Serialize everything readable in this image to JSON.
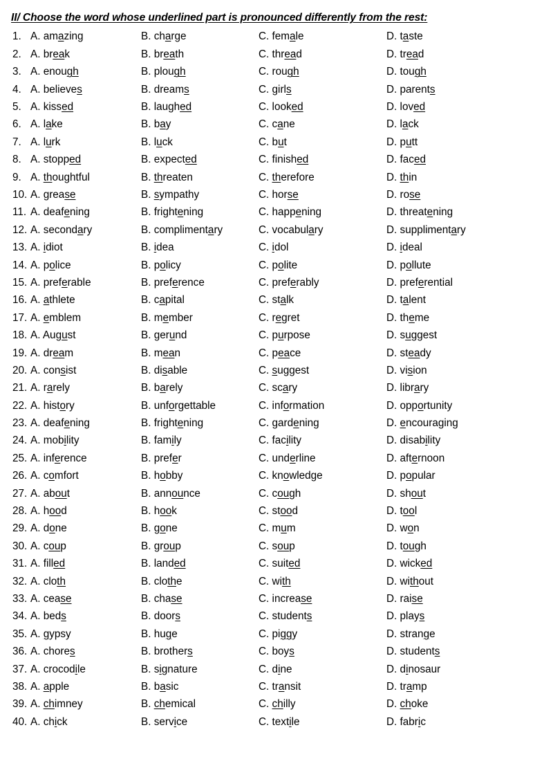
{
  "heading": "II/ Choose the word whose underlined part is pronounced differently from the rest:",
  "columns": [
    "A.",
    "B.",
    "C.",
    "D."
  ],
  "questions": [
    {
      "n": "1.",
      "a": [
        "am",
        "a",
        "zing"
      ],
      "b": [
        "ch",
        "a",
        "rge"
      ],
      "c": [
        "fem",
        "a",
        "le"
      ],
      "d": [
        "t",
        "a",
        "ste"
      ]
    },
    {
      "n": "2.",
      "a": [
        "br",
        "ea",
        "k"
      ],
      "b": [
        "br",
        "ea",
        "th"
      ],
      "c": [
        "thr",
        "ea",
        "d"
      ],
      "d": [
        "tr",
        "ea",
        "d"
      ]
    },
    {
      "n": "3.",
      "a": [
        "enou",
        "gh",
        ""
      ],
      "b": [
        "plou",
        "gh",
        ""
      ],
      "c": [
        "rou",
        "gh",
        ""
      ],
      "d": [
        "tou",
        "gh",
        ""
      ]
    },
    {
      "n": "4.",
      "a": [
        "believe",
        "s",
        ""
      ],
      "b": [
        "dream",
        "s",
        ""
      ],
      "c": [
        "girl",
        "s",
        ""
      ],
      "d": [
        "parent",
        "s",
        ""
      ]
    },
    {
      "n": "5.",
      "a": [
        "kiss",
        "ed",
        ""
      ],
      "b": [
        "laugh",
        "ed",
        ""
      ],
      "c": [
        "look",
        "ed",
        ""
      ],
      "d": [
        "lov",
        "ed",
        ""
      ]
    },
    {
      "n": "6.",
      "a": [
        "l",
        "a",
        "ke"
      ],
      "b": [
        "b",
        "a",
        "y"
      ],
      "c": [
        "c",
        "a",
        "ne"
      ],
      "d": [
        "l",
        "a",
        "ck"
      ]
    },
    {
      "n": "7.",
      "a": [
        "l",
        "u",
        "rk"
      ],
      "b": [
        "l",
        "u",
        "ck"
      ],
      "c": [
        "b",
        "u",
        "t"
      ],
      "d": [
        "p",
        "u",
        "tt"
      ]
    },
    {
      "n": "8.",
      "a": [
        "stopp",
        "ed",
        ""
      ],
      "b": [
        "expect",
        "ed",
        ""
      ],
      "c": [
        "finish",
        "ed",
        ""
      ],
      "d": [
        "fac",
        "ed",
        ""
      ]
    },
    {
      "n": "9.",
      "a": [
        "",
        "th",
        "oughtful"
      ],
      "b": [
        "",
        "th",
        "reaten"
      ],
      "c": [
        "",
        "th",
        "erefore"
      ],
      "d": [
        "",
        "th",
        "in"
      ]
    },
    {
      "n": "10.",
      "a": [
        "grea",
        "se",
        ""
      ],
      "b": [
        "",
        "s",
        "ympathy"
      ],
      "c": [
        "hor",
        "se",
        ""
      ],
      "d": [
        "ro",
        "se",
        ""
      ]
    },
    {
      "n": "11.",
      "a": [
        "deaf",
        "e",
        "ning"
      ],
      "b": [
        "fright",
        "e",
        "ning"
      ],
      "c": [
        "happ",
        "e",
        "ning"
      ],
      "d": [
        "threat",
        "e",
        "ning"
      ]
    },
    {
      "n": "12.",
      "a": [
        "second",
        "a",
        "ry"
      ],
      "b": [
        "compliment",
        "a",
        "ry"
      ],
      "c": [
        "vocabul",
        "a",
        "ry"
      ],
      "d": [
        "suppliment",
        "a",
        "ry"
      ]
    },
    {
      "n": "13.",
      "a": [
        "",
        "i",
        "diot"
      ],
      "b": [
        "",
        "i",
        "dea"
      ],
      "c": [
        "",
        "i",
        "dol"
      ],
      "d": [
        "",
        "i",
        "deal"
      ]
    },
    {
      "n": "14.",
      "a": [
        "p",
        "o",
        "lice"
      ],
      "b": [
        "p",
        "o",
        "licy"
      ],
      "c": [
        "p",
        "o",
        "lite"
      ],
      "d": [
        "p",
        "o",
        "llute"
      ]
    },
    {
      "n": "15.",
      "a": [
        "pref",
        "e",
        "rable"
      ],
      "b": [
        "pref",
        "e",
        "rence"
      ],
      "c": [
        "pref",
        "e",
        "rably"
      ],
      "d": [
        "pref",
        "e",
        "rential"
      ]
    },
    {
      "n": "16.",
      "a": [
        "",
        "a",
        "thlete"
      ],
      "b": [
        "c",
        "a",
        "pital"
      ],
      "c": [
        "st",
        "a",
        "lk"
      ],
      "d": [
        "t",
        "a",
        "lent"
      ]
    },
    {
      "n": "17.",
      "a": [
        "",
        "e",
        "mblem"
      ],
      "b": [
        "m",
        "e",
        "mber"
      ],
      "c": [
        "r",
        "e",
        "gret"
      ],
      "d": [
        "th",
        "e",
        "me"
      ]
    },
    {
      "n": "18.",
      "a": [
        "Aug",
        "u",
        "st"
      ],
      "b": [
        "ger",
        "u",
        "nd"
      ],
      "c": [
        "p",
        "u",
        "rpose"
      ],
      "d": [
        "s",
        "u",
        "ggest"
      ]
    },
    {
      "n": "19.",
      "a": [
        "dr",
        "ea",
        "m"
      ],
      "b": [
        "m",
        "ea",
        "n"
      ],
      "c": [
        "p",
        "ea",
        "ce"
      ],
      "d": [
        "st",
        "ea",
        "dy"
      ]
    },
    {
      "n": "20.",
      "a": [
        "con",
        "s",
        "ist"
      ],
      "b": [
        "di",
        "s",
        "able"
      ],
      "c": [
        "",
        "s",
        "uggest"
      ],
      "d": [
        "vi",
        "s",
        "ion"
      ]
    },
    {
      "n": "21.",
      "a": [
        "r",
        "a",
        "rely"
      ],
      "b": [
        "b",
        "a",
        "rely"
      ],
      "c": [
        "sc",
        "a",
        "ry"
      ],
      "d": [
        "libr",
        "a",
        "ry"
      ]
    },
    {
      "n": "22.",
      "a": [
        "hist",
        "o",
        "ry"
      ],
      "b": [
        "unf",
        "o",
        "rgettable"
      ],
      "c": [
        "inf",
        "o",
        "rmation"
      ],
      "d": [
        "opp",
        "o",
        "rtunity"
      ]
    },
    {
      "n": "23.",
      "a": [
        "deaf",
        "e",
        "ning"
      ],
      "b": [
        "fright",
        "e",
        "ning"
      ],
      "c": [
        "gard",
        "e",
        "ning"
      ],
      "d": [
        "",
        "e",
        "ncouraging"
      ]
    },
    {
      "n": "24.",
      "a": [
        "mob",
        "i",
        "lity"
      ],
      "b": [
        "fam",
        "i",
        "ly"
      ],
      "c": [
        "fac",
        "i",
        "lity"
      ],
      "d": [
        "disab",
        "i",
        "lity"
      ]
    },
    {
      "n": "25.",
      "a": [
        "inf",
        "e",
        "rence"
      ],
      "b": [
        "pref",
        "e",
        "r"
      ],
      "c": [
        "und",
        "e",
        "rline"
      ],
      "d": [
        "aft",
        "e",
        "rnoon"
      ]
    },
    {
      "n": "26.",
      "a": [
        "c",
        "o",
        "mfort"
      ],
      "b": [
        "h",
        "o",
        "bby"
      ],
      "c": [
        "kn",
        "o",
        "wledge"
      ],
      "d": [
        "p",
        "o",
        "pular"
      ]
    },
    {
      "n": "27.",
      "a": [
        "ab",
        "ou",
        "t"
      ],
      "b": [
        "ann",
        "ou",
        "nce"
      ],
      "c": [
        "c",
        "ou",
        "gh"
      ],
      "d": [
        "sh",
        "ou",
        "t"
      ]
    },
    {
      "n": "28.",
      "a": [
        "h",
        "oo",
        "d"
      ],
      "b": [
        "h",
        "oo",
        "k"
      ],
      "c": [
        "st",
        "oo",
        "d"
      ],
      "d": [
        "t",
        "oo",
        "l"
      ]
    },
    {
      "n": "29.",
      "a": [
        "d",
        "o",
        "ne"
      ],
      "b": [
        "g",
        "o",
        "ne"
      ],
      "c": [
        "m",
        "u",
        "m"
      ],
      "d": [
        "w",
        "o",
        "n"
      ]
    },
    {
      "n": "30.",
      "a": [
        "c",
        "ou",
        "p"
      ],
      "b": [
        "gr",
        "ou",
        "p"
      ],
      "c": [
        "s",
        "ou",
        "p"
      ],
      "d": [
        "t",
        "ou",
        "gh"
      ]
    },
    {
      "n": "31.",
      "a": [
        "fill",
        "ed",
        ""
      ],
      "b": [
        "land",
        "ed",
        ""
      ],
      "c": [
        "suit",
        "ed",
        ""
      ],
      "d": [
        "wick",
        "ed",
        ""
      ]
    },
    {
      "n": "32.",
      "a": [
        "clo",
        "th",
        ""
      ],
      "b": [
        "clo",
        "th",
        "e"
      ],
      "c": [
        "wi",
        "th",
        ""
      ],
      "d": [
        "wi",
        "th",
        "out"
      ]
    },
    {
      "n": "33.",
      "a": [
        "cea",
        "se",
        ""
      ],
      "b": [
        "cha",
        "se",
        ""
      ],
      "c": [
        "increa",
        "se",
        ""
      ],
      "d": [
        "rai",
        "se",
        ""
      ]
    },
    {
      "n": "34.",
      "a": [
        "bed",
        "s",
        ""
      ],
      "b": [
        "door",
        "s",
        ""
      ],
      "c": [
        "student",
        "s",
        ""
      ],
      "d": [
        "play",
        "s",
        ""
      ]
    },
    {
      "n": "35.",
      "a": [
        "",
        "g",
        "ypsy"
      ],
      "b": [
        "hu",
        "g",
        "e"
      ],
      "c": [
        "pi",
        "gg",
        "y"
      ],
      "d": [
        "stran",
        "g",
        "e"
      ]
    },
    {
      "n": "36.",
      "a": [
        "chore",
        "s",
        ""
      ],
      "b": [
        "brother",
        "s",
        ""
      ],
      "c": [
        "boy",
        "s",
        ""
      ],
      "d": [
        "student",
        "s",
        ""
      ]
    },
    {
      "n": "37.",
      "a": [
        "crocod",
        "i",
        "le"
      ],
      "b": [
        "s",
        "i",
        "gnature"
      ],
      "c": [
        "d",
        "i",
        "ne"
      ],
      "d": [
        "d",
        "i",
        "nosaur"
      ]
    },
    {
      "n": "38.",
      "a": [
        "",
        "a",
        "pple"
      ],
      "b": [
        "b",
        "a",
        "sic"
      ],
      "c": [
        "tr",
        "a",
        "nsit"
      ],
      "d": [
        "tr",
        "a",
        "mp"
      ]
    },
    {
      "n": "39.",
      "a": [
        "",
        "ch",
        "imney"
      ],
      "b": [
        "",
        "ch",
        "emical"
      ],
      "c": [
        "",
        "ch",
        "illy"
      ],
      "d": [
        "",
        "ch",
        "oke"
      ]
    },
    {
      "n": "40.",
      "a": [
        "ch",
        "i",
        "ck"
      ],
      "b": [
        "serv",
        "i",
        "ce"
      ],
      "c": [
        "text",
        "i",
        "le"
      ],
      "d": [
        "fabr",
        "i",
        "c"
      ]
    }
  ]
}
